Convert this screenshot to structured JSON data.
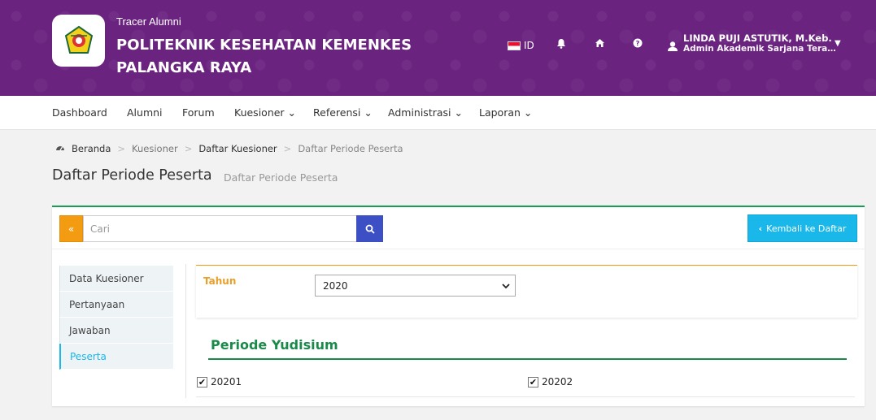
{
  "header": {
    "subtitle": "Tracer Alumni",
    "title": "POLITEKNIK KESEHATAN KEMENKES PALANGKA RAYA",
    "lang": "ID",
    "user_name": "LINDA PUJI ASTUTIK, M.Keb.",
    "user_role": "Admin Akademik Sarjana Tera…"
  },
  "nav": {
    "items": [
      {
        "label": "Dashboard"
      },
      {
        "label": "Alumni"
      },
      {
        "label": "Forum"
      },
      {
        "label": "Kuesioner ⌄"
      },
      {
        "label": "Referensi ⌄"
      },
      {
        "label": "Administrasi ⌄"
      },
      {
        "label": "Laporan ⌄"
      }
    ]
  },
  "breadcrumb": {
    "home": "Beranda",
    "items": [
      "Kuesioner",
      "Daftar Kuesioner",
      "Daftar Periode Peserta"
    ]
  },
  "page": {
    "title": "Daftar Periode Peserta",
    "subtitle": "Daftar Periode Peserta"
  },
  "toolbar": {
    "search_placeholder": "Cari",
    "back_label": "Kembali ke Daftar"
  },
  "side_menu": [
    {
      "label": "Data Kuesioner"
    },
    {
      "label": "Pertanyaan"
    },
    {
      "label": "Jawaban"
    },
    {
      "label": "Peserta"
    }
  ],
  "filter": {
    "label": "Tahun",
    "selected": "2020"
  },
  "section": {
    "title": "Periode Yudisium",
    "checkboxes": [
      {
        "label": "20201",
        "checked": true
      },
      {
        "label": "20202",
        "checked": true
      }
    ]
  },
  "colors": {
    "header_bg": "#6a237f",
    "accent_green": "#1a8a4a",
    "accent_orange": "#f39c12",
    "accent_blue": "#1ab7ea",
    "search_btn": "#3c4fc4"
  }
}
